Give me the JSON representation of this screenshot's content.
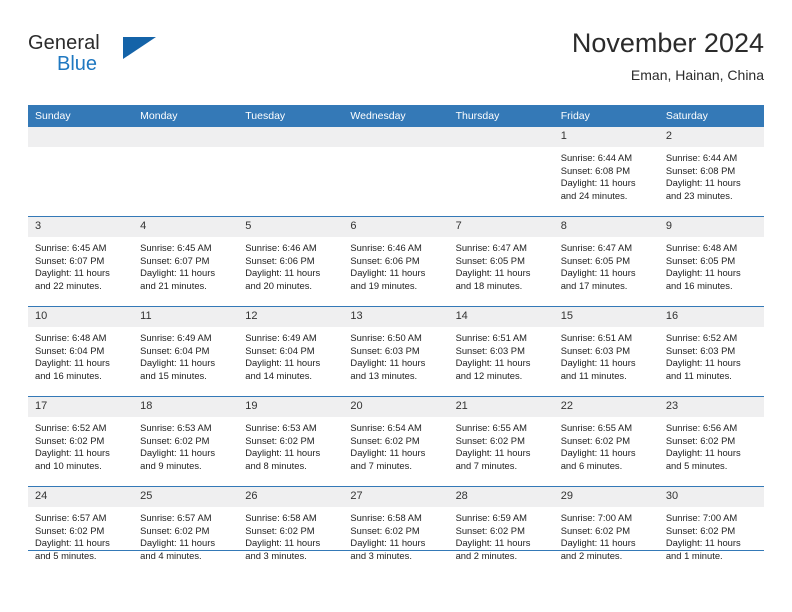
{
  "brand": {
    "word1": "General",
    "word2": "Blue",
    "logo_icon": "triangle-logo-icon",
    "blue_hex": "#1f78c1",
    "dark_blue_hex": "#1463a8"
  },
  "header": {
    "title": "November 2024",
    "subtitle": "Eman, Hainan, China"
  },
  "theme": {
    "header_bg": "#3479b7",
    "daynum_bg": "#efeff0",
    "cell_bg": "#ffffff",
    "text": "#222222"
  },
  "calendar": {
    "weekday_headers": [
      "Sunday",
      "Monday",
      "Tuesday",
      "Wednesday",
      "Thursday",
      "Friday",
      "Saturday"
    ],
    "weeks": [
      [
        {
          "day": "",
          "sunrise": "",
          "sunset": "",
          "daylight1": "",
          "daylight2": "",
          "empty": true
        },
        {
          "day": "",
          "sunrise": "",
          "sunset": "",
          "daylight1": "",
          "daylight2": "",
          "empty": true
        },
        {
          "day": "",
          "sunrise": "",
          "sunset": "",
          "daylight1": "",
          "daylight2": "",
          "empty": true
        },
        {
          "day": "",
          "sunrise": "",
          "sunset": "",
          "daylight1": "",
          "daylight2": "",
          "empty": true
        },
        {
          "day": "",
          "sunrise": "",
          "sunset": "",
          "daylight1": "",
          "daylight2": "",
          "empty": true
        },
        {
          "day": "1",
          "sunrise": "Sunrise: 6:44 AM",
          "sunset": "Sunset: 6:08 PM",
          "daylight1": "Daylight: 11 hours",
          "daylight2": "and 24 minutes.",
          "empty": false
        },
        {
          "day": "2",
          "sunrise": "Sunrise: 6:44 AM",
          "sunset": "Sunset: 6:08 PM",
          "daylight1": "Daylight: 11 hours",
          "daylight2": "and 23 minutes.",
          "empty": false
        }
      ],
      [
        {
          "day": "3",
          "sunrise": "Sunrise: 6:45 AM",
          "sunset": "Sunset: 6:07 PM",
          "daylight1": "Daylight: 11 hours",
          "daylight2": "and 22 minutes.",
          "empty": false
        },
        {
          "day": "4",
          "sunrise": "Sunrise: 6:45 AM",
          "sunset": "Sunset: 6:07 PM",
          "daylight1": "Daylight: 11 hours",
          "daylight2": "and 21 minutes.",
          "empty": false
        },
        {
          "day": "5",
          "sunrise": "Sunrise: 6:46 AM",
          "sunset": "Sunset: 6:06 PM",
          "daylight1": "Daylight: 11 hours",
          "daylight2": "and 20 minutes.",
          "empty": false
        },
        {
          "day": "6",
          "sunrise": "Sunrise: 6:46 AM",
          "sunset": "Sunset: 6:06 PM",
          "daylight1": "Daylight: 11 hours",
          "daylight2": "and 19 minutes.",
          "empty": false
        },
        {
          "day": "7",
          "sunrise": "Sunrise: 6:47 AM",
          "sunset": "Sunset: 6:05 PM",
          "daylight1": "Daylight: 11 hours",
          "daylight2": "and 18 minutes.",
          "empty": false
        },
        {
          "day": "8",
          "sunrise": "Sunrise: 6:47 AM",
          "sunset": "Sunset: 6:05 PM",
          "daylight1": "Daylight: 11 hours",
          "daylight2": "and 17 minutes.",
          "empty": false
        },
        {
          "day": "9",
          "sunrise": "Sunrise: 6:48 AM",
          "sunset": "Sunset: 6:05 PM",
          "daylight1": "Daylight: 11 hours",
          "daylight2": "and 16 minutes.",
          "empty": false
        }
      ],
      [
        {
          "day": "10",
          "sunrise": "Sunrise: 6:48 AM",
          "sunset": "Sunset: 6:04 PM",
          "daylight1": "Daylight: 11 hours",
          "daylight2": "and 16 minutes.",
          "empty": false
        },
        {
          "day": "11",
          "sunrise": "Sunrise: 6:49 AM",
          "sunset": "Sunset: 6:04 PM",
          "daylight1": "Daylight: 11 hours",
          "daylight2": "and 15 minutes.",
          "empty": false
        },
        {
          "day": "12",
          "sunrise": "Sunrise: 6:49 AM",
          "sunset": "Sunset: 6:04 PM",
          "daylight1": "Daylight: 11 hours",
          "daylight2": "and 14 minutes.",
          "empty": false
        },
        {
          "day": "13",
          "sunrise": "Sunrise: 6:50 AM",
          "sunset": "Sunset: 6:03 PM",
          "daylight1": "Daylight: 11 hours",
          "daylight2": "and 13 minutes.",
          "empty": false
        },
        {
          "day": "14",
          "sunrise": "Sunrise: 6:51 AM",
          "sunset": "Sunset: 6:03 PM",
          "daylight1": "Daylight: 11 hours",
          "daylight2": "and 12 minutes.",
          "empty": false
        },
        {
          "day": "15",
          "sunrise": "Sunrise: 6:51 AM",
          "sunset": "Sunset: 6:03 PM",
          "daylight1": "Daylight: 11 hours",
          "daylight2": "and 11 minutes.",
          "empty": false
        },
        {
          "day": "16",
          "sunrise": "Sunrise: 6:52 AM",
          "sunset": "Sunset: 6:03 PM",
          "daylight1": "Daylight: 11 hours",
          "daylight2": "and 11 minutes.",
          "empty": false
        }
      ],
      [
        {
          "day": "17",
          "sunrise": "Sunrise: 6:52 AM",
          "sunset": "Sunset: 6:02 PM",
          "daylight1": "Daylight: 11 hours",
          "daylight2": "and 10 minutes.",
          "empty": false
        },
        {
          "day": "18",
          "sunrise": "Sunrise: 6:53 AM",
          "sunset": "Sunset: 6:02 PM",
          "daylight1": "Daylight: 11 hours",
          "daylight2": "and 9 minutes.",
          "empty": false
        },
        {
          "day": "19",
          "sunrise": "Sunrise: 6:53 AM",
          "sunset": "Sunset: 6:02 PM",
          "daylight1": "Daylight: 11 hours",
          "daylight2": "and 8 minutes.",
          "empty": false
        },
        {
          "day": "20",
          "sunrise": "Sunrise: 6:54 AM",
          "sunset": "Sunset: 6:02 PM",
          "daylight1": "Daylight: 11 hours",
          "daylight2": "and 7 minutes.",
          "empty": false
        },
        {
          "day": "21",
          "sunrise": "Sunrise: 6:55 AM",
          "sunset": "Sunset: 6:02 PM",
          "daylight1": "Daylight: 11 hours",
          "daylight2": "and 7 minutes.",
          "empty": false
        },
        {
          "day": "22",
          "sunrise": "Sunrise: 6:55 AM",
          "sunset": "Sunset: 6:02 PM",
          "daylight1": "Daylight: 11 hours",
          "daylight2": "and 6 minutes.",
          "empty": false
        },
        {
          "day": "23",
          "sunrise": "Sunrise: 6:56 AM",
          "sunset": "Sunset: 6:02 PM",
          "daylight1": "Daylight: 11 hours",
          "daylight2": "and 5 minutes.",
          "empty": false
        }
      ],
      [
        {
          "day": "24",
          "sunrise": "Sunrise: 6:57 AM",
          "sunset": "Sunset: 6:02 PM",
          "daylight1": "Daylight: 11 hours",
          "daylight2": "and 5 minutes.",
          "empty": false
        },
        {
          "day": "25",
          "sunrise": "Sunrise: 6:57 AM",
          "sunset": "Sunset: 6:02 PM",
          "daylight1": "Daylight: 11 hours",
          "daylight2": "and 4 minutes.",
          "empty": false
        },
        {
          "day": "26",
          "sunrise": "Sunrise: 6:58 AM",
          "sunset": "Sunset: 6:02 PM",
          "daylight1": "Daylight: 11 hours",
          "daylight2": "and 3 minutes.",
          "empty": false
        },
        {
          "day": "27",
          "sunrise": "Sunrise: 6:58 AM",
          "sunset": "Sunset: 6:02 PM",
          "daylight1": "Daylight: 11 hours",
          "daylight2": "and 3 minutes.",
          "empty": false
        },
        {
          "day": "28",
          "sunrise": "Sunrise: 6:59 AM",
          "sunset": "Sunset: 6:02 PM",
          "daylight1": "Daylight: 11 hours",
          "daylight2": "and 2 minutes.",
          "empty": false
        },
        {
          "day": "29",
          "sunrise": "Sunrise: 7:00 AM",
          "sunset": "Sunset: 6:02 PM",
          "daylight1": "Daylight: 11 hours",
          "daylight2": "and 2 minutes.",
          "empty": false
        },
        {
          "day": "30",
          "sunrise": "Sunrise: 7:00 AM",
          "sunset": "Sunset: 6:02 PM",
          "daylight1": "Daylight: 11 hours",
          "daylight2": "and 1 minute.",
          "empty": false
        }
      ]
    ]
  }
}
